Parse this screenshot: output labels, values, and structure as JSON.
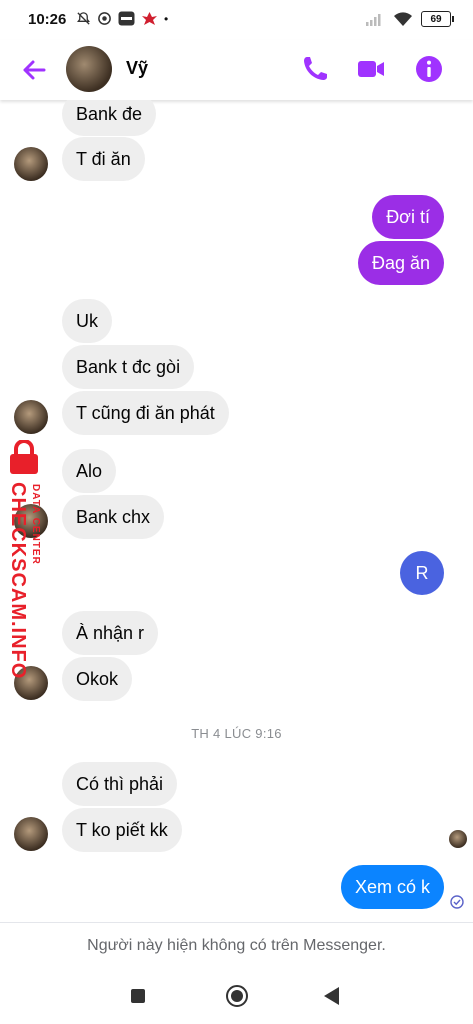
{
  "status_bar": {
    "time": "10:26",
    "battery": "69"
  },
  "header": {
    "contact_name": "Vỹ",
    "accent_color": "#a033ff"
  },
  "messages": [
    {
      "dir": "in",
      "text": "Bank đe"
    },
    {
      "dir": "in",
      "text": "T đi ăn"
    },
    {
      "dir": "out",
      "text": "Đơi tí",
      "color": "#9b2ee6"
    },
    {
      "dir": "out",
      "text": "Đag ăn",
      "color": "#9b2ee6"
    },
    {
      "dir": "in",
      "text": "Uk"
    },
    {
      "dir": "in",
      "text": "Bank t đc gòi"
    },
    {
      "dir": "in",
      "text": "T cũng đi ăn phát"
    },
    {
      "dir": "in",
      "text": "Alo"
    },
    {
      "dir": "in",
      "text": "Bank chx"
    },
    {
      "dir": "out-avatar",
      "text": "R"
    },
    {
      "dir": "in",
      "text": "À nhận r"
    },
    {
      "dir": "in",
      "text": "Okok"
    },
    {
      "dir": "in",
      "text": "Có thì phải"
    },
    {
      "dir": "in",
      "text": "T ko piết kk"
    },
    {
      "dir": "out",
      "text": "Xem có k",
      "color": "#0b84ff"
    }
  ],
  "time_separator": "TH 4 LÚC 9:16",
  "watermark": {
    "line1": "CHECKSCAM.INFO",
    "line2": "DATA CENTER"
  },
  "footer_note": "Người này hiện không có trên Messenger."
}
